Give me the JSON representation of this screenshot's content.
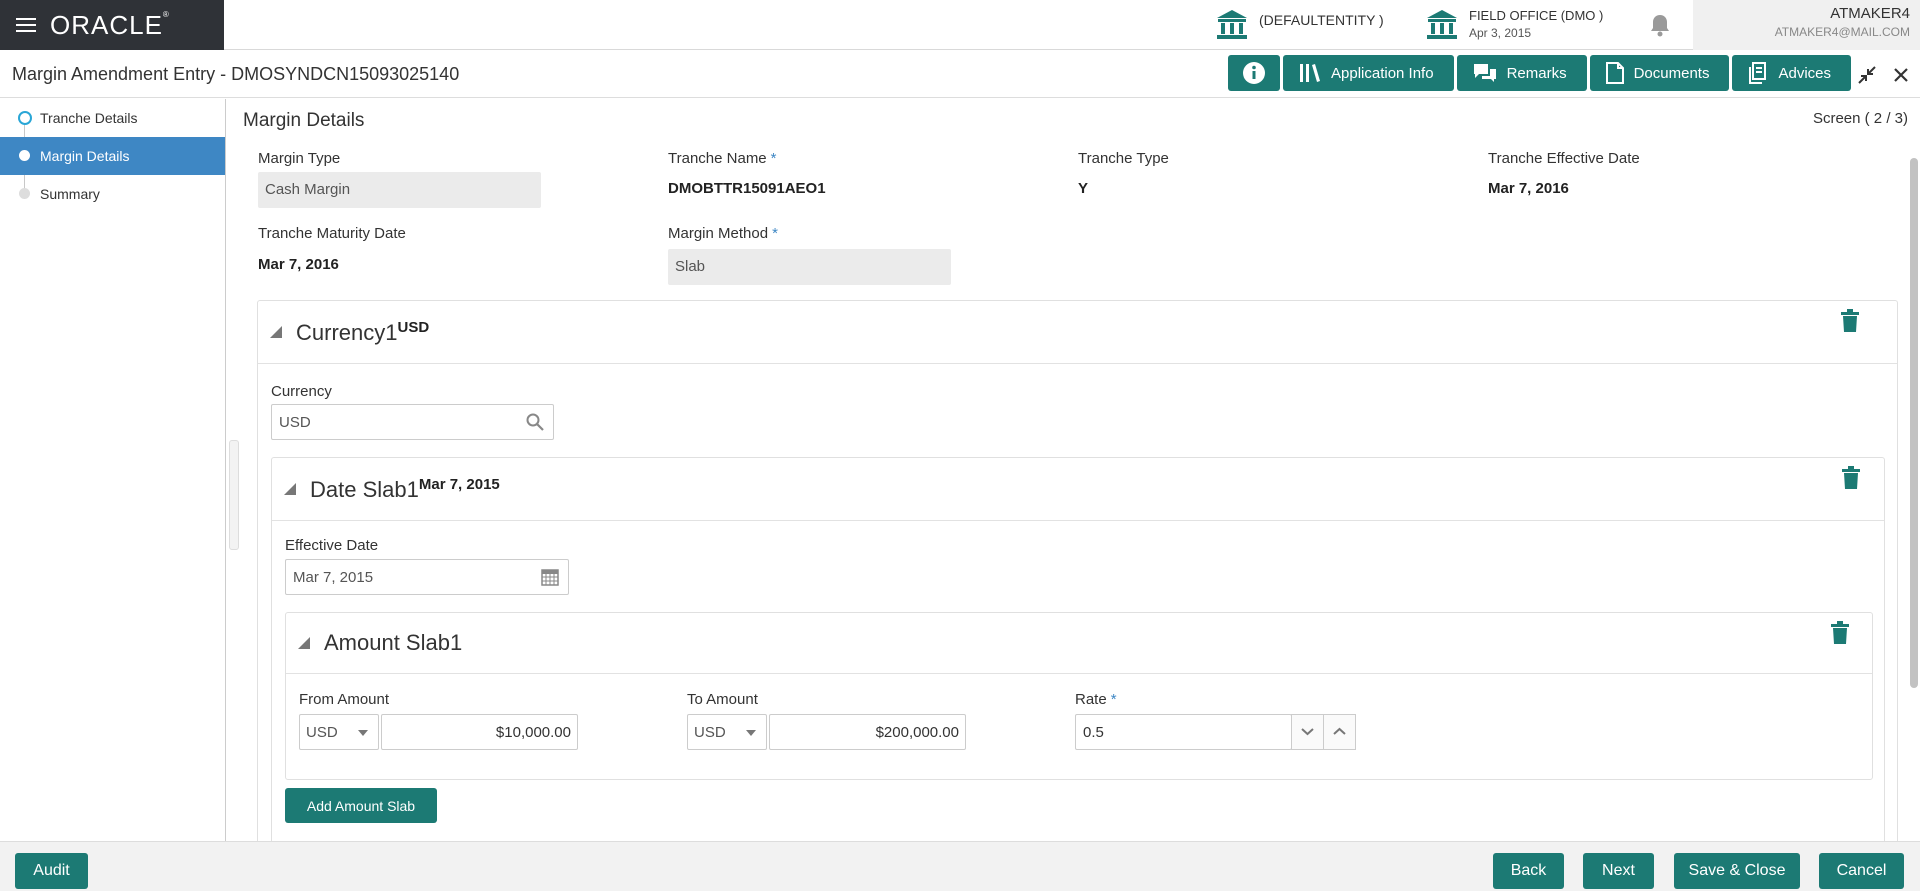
{
  "header": {
    "brand": "ORACLE",
    "entity": "(DEFAULTENTITY )",
    "office": {
      "name": "FIELD OFFICE  (DMO )",
      "date": "Apr 3, 2015"
    },
    "user": {
      "name": "ATMAKER4",
      "email": "ATMAKER4@MAIL.COM"
    }
  },
  "titlebar": {
    "title": "Margin Amendment Entry - DMOSYNDCN15093025140",
    "buttons": {
      "application_info": "Application Info",
      "remarks": "Remarks",
      "documents": "Documents",
      "advices": "Advices"
    }
  },
  "sidebar": {
    "steps": [
      {
        "label": "Tranche Details"
      },
      {
        "label": "Margin Details"
      },
      {
        "label": "Summary"
      }
    ]
  },
  "main": {
    "section_title": "Margin Details",
    "screen_indicator": "Screen ( 2 / 3)",
    "fields": {
      "margin_type": {
        "label": "Margin Type",
        "value": "Cash Margin"
      },
      "tranche_name": {
        "label": "Tranche Name",
        "value": "DMOBTTR15091AEO1",
        "required": "*"
      },
      "tranche_type": {
        "label": "Tranche Type",
        "value": "Y"
      },
      "tranche_effective_date": {
        "label": "Tranche Effective Date",
        "value": "Mar 7, 2016"
      },
      "tranche_maturity_date": {
        "label": "Tranche Maturity Date",
        "value": "Mar 7, 2016"
      },
      "margin_method": {
        "label": "Margin Method",
        "value": "Slab",
        "required": "*"
      }
    },
    "currency_panel": {
      "title": "Currency1",
      "title_sup": "USD",
      "currency_label": "Currency",
      "currency_value": "USD"
    },
    "date_slab_panel": {
      "title": "Date Slab1",
      "title_sup": "Mar 7, 2015",
      "effective_date_label": "Effective Date",
      "effective_date_value": "Mar 7, 2015"
    },
    "amount_slab_panel": {
      "title": "Amount Slab1",
      "from_amount": {
        "label": "From Amount",
        "currency": "USD",
        "value": "$10,000.00"
      },
      "to_amount": {
        "label": "To Amount",
        "currency": "USD",
        "value": "$200,000.00"
      },
      "rate": {
        "label": "Rate",
        "value": "0.5",
        "required": "*"
      }
    },
    "add_amount_slab": "Add Amount Slab"
  },
  "footer": {
    "audit": "Audit",
    "back": "Back",
    "next": "Next",
    "save_close": "Save & Close",
    "cancel": "Cancel"
  },
  "colors": {
    "accent": "#1c7a74",
    "active_step": "#3e87c4",
    "brand_bar": "#2f3237"
  }
}
